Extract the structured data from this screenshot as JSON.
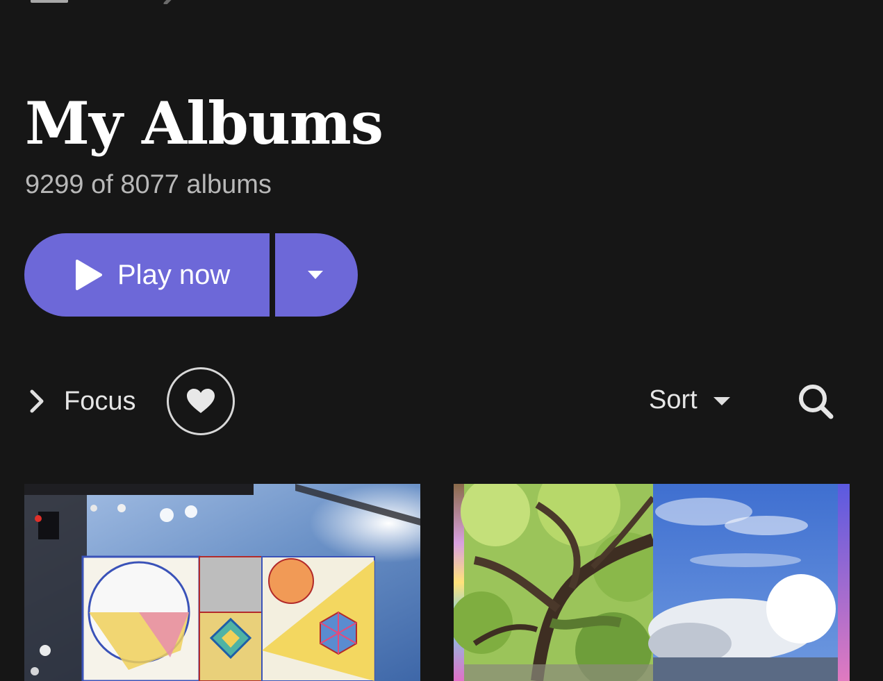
{
  "header": {
    "title": "My Albums",
    "count_text": "9299 of 8077 albums"
  },
  "actions": {
    "play_label": "Play now"
  },
  "filters": {
    "focus_label": "Focus",
    "sort_label": "Sort"
  },
  "icons": {
    "menu": "menu-icon",
    "back": "back-arrow-icon",
    "top_search": "search-icon",
    "play": "play-icon",
    "dropdown": "caret-down-icon",
    "chevron": "chevron-right-icon",
    "heart": "heart-icon",
    "search": "search-icon"
  },
  "colors": {
    "background": "#161616",
    "accent": "#6d68d8",
    "text_primary": "#ffffff",
    "text_secondary": "#b8b8b8"
  },
  "albums": [
    {
      "artwork": "geometric-drawing-on-stage"
    },
    {
      "artwork": "tree-and-sky-collage"
    }
  ]
}
